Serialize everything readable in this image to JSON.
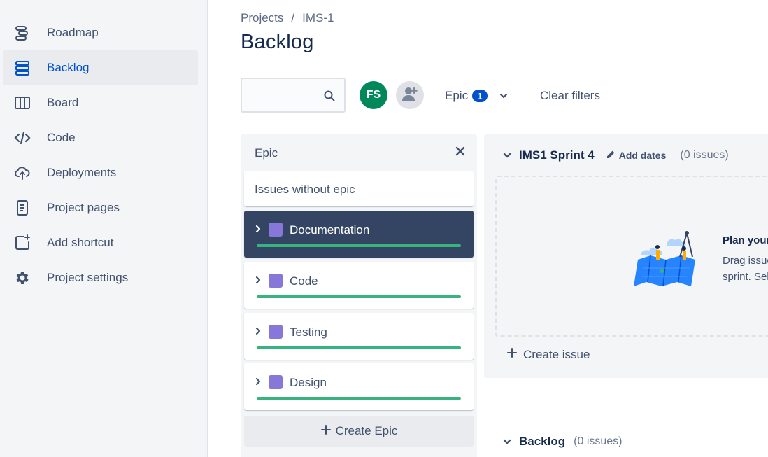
{
  "sidebar": {
    "items": [
      {
        "label": "Roadmap",
        "icon": "roadmap-icon",
        "active": false
      },
      {
        "label": "Backlog",
        "icon": "backlog-icon",
        "active": true
      },
      {
        "label": "Board",
        "icon": "board-icon",
        "active": false
      },
      {
        "label": "Code",
        "icon": "code-icon",
        "active": false
      },
      {
        "label": "Deployments",
        "icon": "cloud-upload-icon",
        "active": false
      },
      {
        "label": "Project pages",
        "icon": "page-icon",
        "active": false
      },
      {
        "label": "Add shortcut",
        "icon": "add-shortcut-icon",
        "active": false
      },
      {
        "label": "Project settings",
        "icon": "gear-icon",
        "active": false
      }
    ]
  },
  "header": {
    "breadcrumb": [
      "Projects",
      "/",
      "IMS-1"
    ],
    "title": "Backlog"
  },
  "filters": {
    "search_value": "",
    "avatar_initials": "FS",
    "epic_label": "Epic",
    "epic_count": "1",
    "clear_label": "Clear filters"
  },
  "epic_panel": {
    "title": "Epic",
    "no_epic_label": "Issues without epic",
    "epics": [
      {
        "name": "Documentation",
        "color": "#8777d9",
        "selected": true
      },
      {
        "name": "Code",
        "color": "#8777d9",
        "selected": false
      },
      {
        "name": "Testing",
        "color": "#8777d9",
        "selected": false
      },
      {
        "name": "Design",
        "color": "#8777d9",
        "selected": false
      }
    ],
    "create_label": "Create Epic"
  },
  "sprint": {
    "name": "IMS1 Sprint 4",
    "add_dates_label": "Add dates",
    "issue_count": "(0 issues)",
    "empty_title": "Plan your",
    "empty_text_line1": "Drag issue",
    "empty_text_line2": "sprint. Sel",
    "create_issue_label": "Create issue"
  },
  "backlog": {
    "name": "Backlog",
    "issue_count": "(0 issues)"
  },
  "colors": {
    "accent": "#0052cc",
    "progress": "#36b37e",
    "selected_card": "#344563",
    "avatar_bg": "#00875a"
  }
}
